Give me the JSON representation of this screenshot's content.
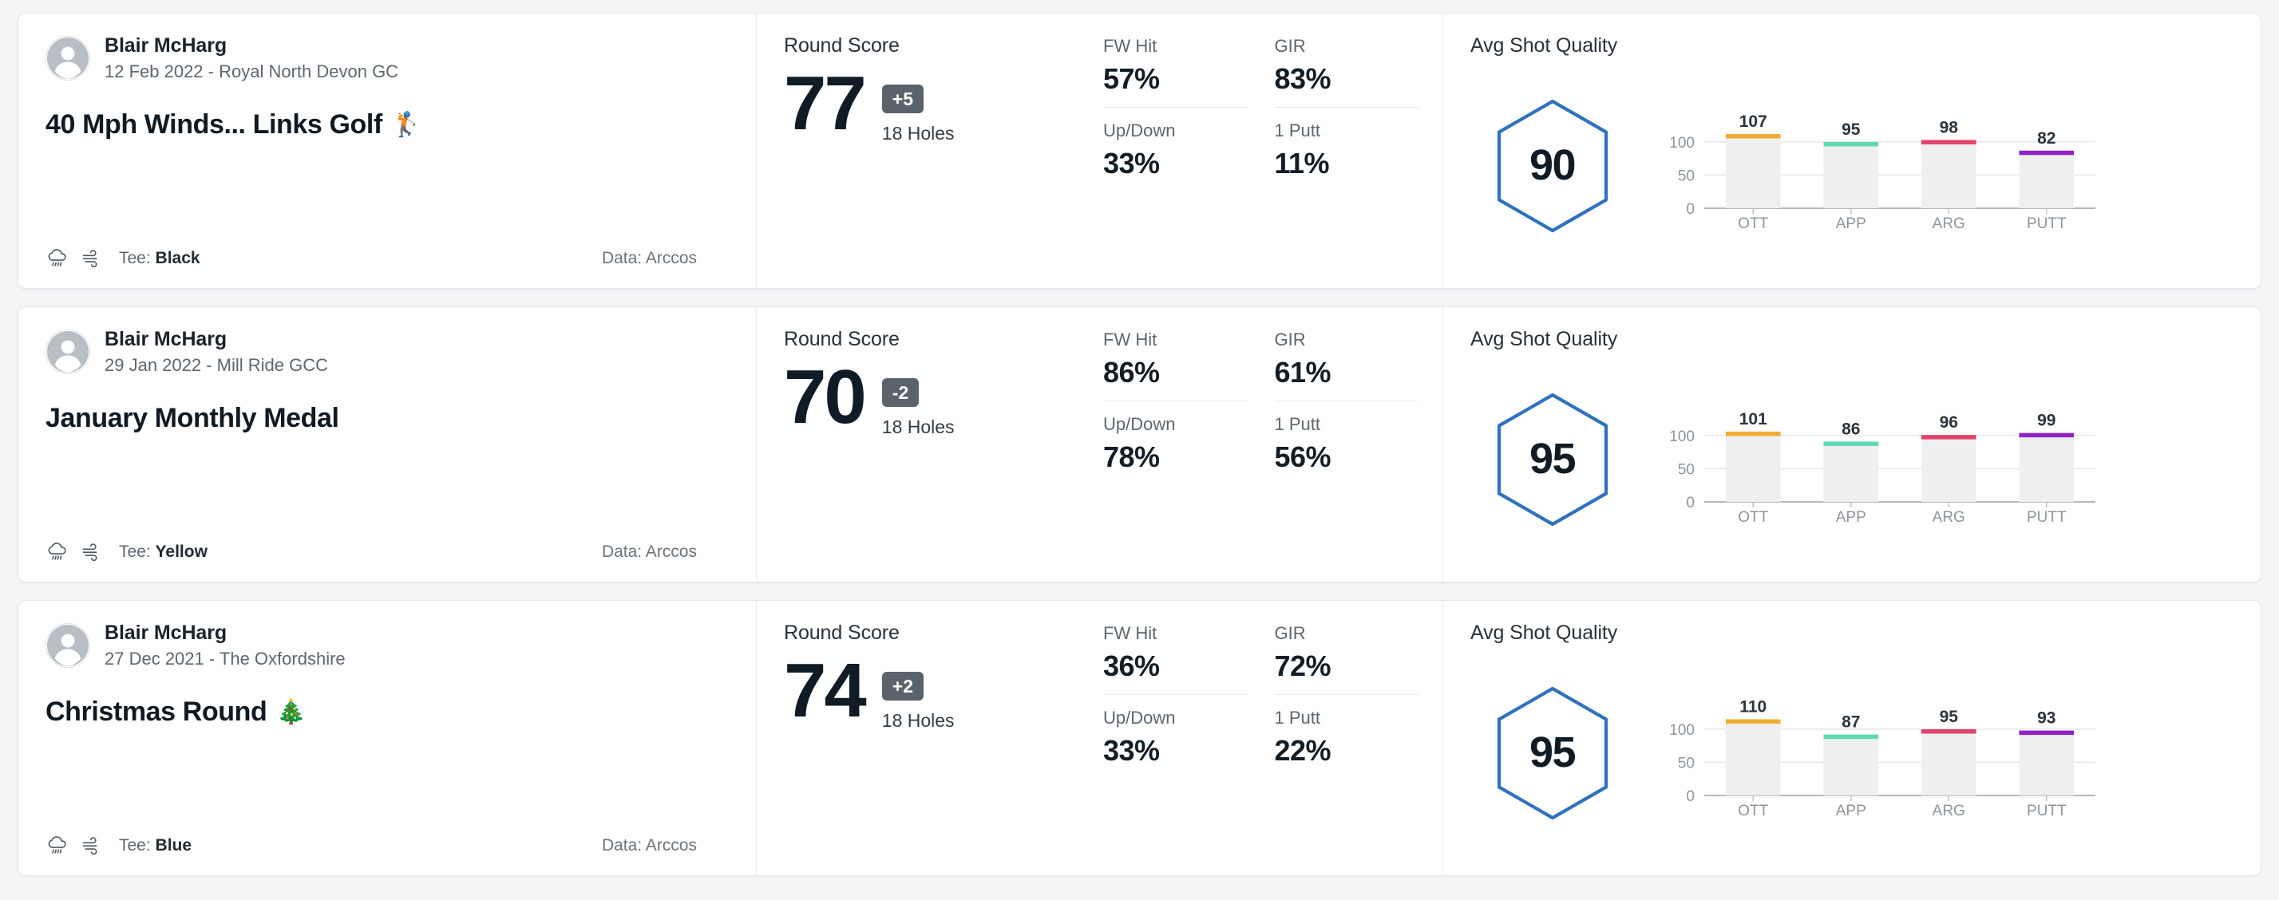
{
  "rounds": [
    {
      "player": "Blair McHarg",
      "meta": "12 Feb 2022 - Royal North Devon GC",
      "title": "40 Mph Winds... Links Golf",
      "title_emoji": "🏌️",
      "tee_label": "Tee:",
      "tee_value": "Black",
      "data_source": "Data: Arccos",
      "weather_icons": [
        "rain-cloud-icon",
        "wind-icon"
      ],
      "score_label": "Round Score",
      "score": "77",
      "to_par": "+5",
      "holes": "18 Holes",
      "stats": [
        {
          "label": "FW Hit",
          "value": "57%"
        },
        {
          "label": "GIR",
          "value": "83%"
        },
        {
          "label": "Up/Down",
          "value": "33%"
        },
        {
          "label": "1 Putt",
          "value": "11%"
        }
      ],
      "quality_label": "Avg Shot Quality",
      "quality_score": "90",
      "chart_data": {
        "type": "bar",
        "categories": [
          "OTT",
          "APP",
          "ARG",
          "PUTT"
        ],
        "values": [
          107,
          95,
          98,
          82
        ],
        "title": "Avg Shot Quality",
        "xlabel": "",
        "ylabel": "",
        "ylim": [
          0,
          125
        ],
        "yticks": [
          0,
          50,
          100
        ],
        "grid": true,
        "legend": "none",
        "bar_colors": [
          "#f0ad33",
          "#5fd9b4",
          "#e2436a",
          "#8e22c4"
        ]
      }
    },
    {
      "player": "Blair McHarg",
      "meta": "29 Jan 2022 - Mill Ride GCC",
      "title": "January Monthly Medal",
      "title_emoji": "",
      "tee_label": "Tee:",
      "tee_value": "Yellow",
      "data_source": "Data: Arccos",
      "weather_icons": [
        "rain-cloud-icon",
        "wind-icon"
      ],
      "score_label": "Round Score",
      "score": "70",
      "to_par": "-2",
      "holes": "18 Holes",
      "stats": [
        {
          "label": "FW Hit",
          "value": "86%"
        },
        {
          "label": "GIR",
          "value": "61%"
        },
        {
          "label": "Up/Down",
          "value": "78%"
        },
        {
          "label": "1 Putt",
          "value": "56%"
        }
      ],
      "quality_label": "Avg Shot Quality",
      "quality_score": "95",
      "chart_data": {
        "type": "bar",
        "categories": [
          "OTT",
          "APP",
          "ARG",
          "PUTT"
        ],
        "values": [
          101,
          86,
          96,
          99
        ],
        "title": "Avg Shot Quality",
        "xlabel": "",
        "ylabel": "",
        "ylim": [
          0,
          125
        ],
        "yticks": [
          0,
          50,
          100
        ],
        "grid": true,
        "legend": "none",
        "bar_colors": [
          "#f0ad33",
          "#5fd9b4",
          "#e2436a",
          "#8e22c4"
        ]
      }
    },
    {
      "player": "Blair McHarg",
      "meta": "27 Dec 2021 - The Oxfordshire",
      "title": "Christmas Round",
      "title_emoji": "🎄",
      "tee_label": "Tee:",
      "tee_value": "Blue",
      "data_source": "Data: Arccos",
      "weather_icons": [
        "rain-cloud-icon",
        "wind-icon"
      ],
      "score_label": "Round Score",
      "score": "74",
      "to_par": "+2",
      "holes": "18 Holes",
      "stats": [
        {
          "label": "FW Hit",
          "value": "36%"
        },
        {
          "label": "GIR",
          "value": "72%"
        },
        {
          "label": "Up/Down",
          "value": "33%"
        },
        {
          "label": "1 Putt",
          "value": "22%"
        }
      ],
      "quality_label": "Avg Shot Quality",
      "quality_score": "95",
      "chart_data": {
        "type": "bar",
        "categories": [
          "OTT",
          "APP",
          "ARG",
          "PUTT"
        ],
        "values": [
          110,
          87,
          95,
          93
        ],
        "title": "Avg Shot Quality",
        "xlabel": "",
        "ylabel": "",
        "ylim": [
          0,
          125
        ],
        "yticks": [
          0,
          50,
          100
        ],
        "grid": true,
        "legend": "none",
        "bar_colors": [
          "#f0ad33",
          "#5fd9b4",
          "#e2436a",
          "#8e22c4"
        ]
      }
    }
  ],
  "colors": {
    "accent_hex": "#2f72bd",
    "badge_bg": "#5a636c",
    "score_text": "#101b26",
    "page_bg": "#f4f5f6",
    "card_bg": "#ffffff"
  }
}
